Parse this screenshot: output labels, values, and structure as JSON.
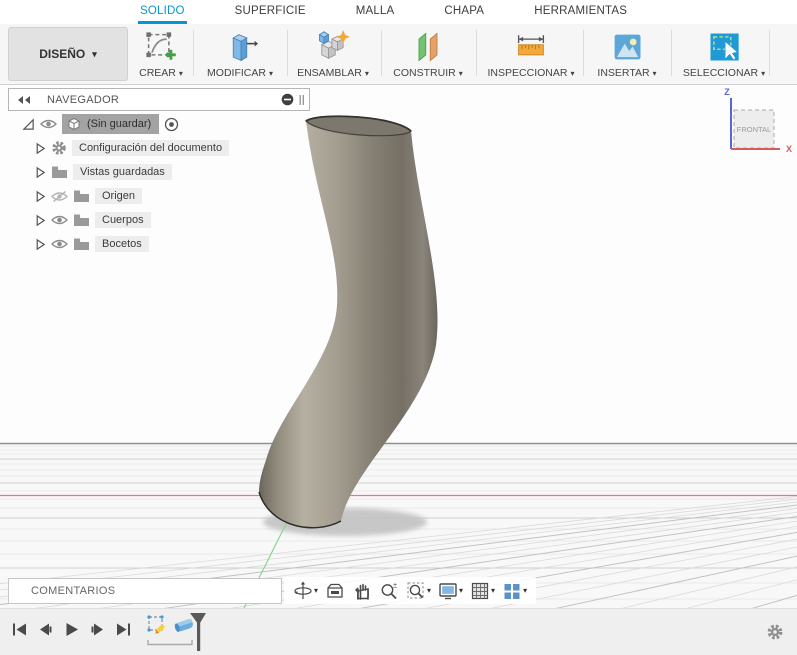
{
  "glyphs": {
    "caret": "▾"
  },
  "tabs": {
    "items": [
      {
        "label": "SOLIDO",
        "active": true
      },
      {
        "label": "SUPERFICIE",
        "active": false
      },
      {
        "label": "MALLA",
        "active": false
      },
      {
        "label": "CHAPA",
        "active": false
      },
      {
        "label": "HERRAMIENTAS",
        "active": false
      }
    ]
  },
  "design_menu": {
    "label": "DISEÑO"
  },
  "toolbar": {
    "groups": [
      {
        "label": "CREAR",
        "icon": "sketch-create-icon"
      },
      {
        "label": "MODIFICAR",
        "icon": "press-pull-icon"
      },
      {
        "label": "ENSAMBLAR",
        "icon": "assemble-icon"
      },
      {
        "label": "CONSTRUIR",
        "icon": "construct-planes-icon"
      },
      {
        "label": "INSPECCIONAR",
        "icon": "measure-icon"
      },
      {
        "label": "INSERTAR",
        "icon": "insert-image-icon"
      },
      {
        "label": "SELECCIONAR",
        "icon": "select-icon"
      }
    ]
  },
  "navigator": {
    "title": "NAVEGADOR",
    "document": {
      "label": "(Sin guardar)"
    },
    "rows": [
      {
        "label": "Configuración del documento",
        "icon": "gear-icon"
      },
      {
        "label": "Vistas guardadas",
        "icon": "folder-icon"
      },
      {
        "label": "Origen",
        "icon": "folder-icon",
        "visible": false
      },
      {
        "label": "Cuerpos",
        "icon": "folder-icon",
        "visible": true
      },
      {
        "label": "Bocetos",
        "icon": "folder-icon",
        "visible": true
      }
    ]
  },
  "viewcube": {
    "face_label": "FRONTAL",
    "z_label": "Z",
    "x_label": "X"
  },
  "comments_panel": {
    "label": "COMENTARIOS"
  },
  "view_toolbar": {
    "icons": [
      "orbit",
      "look-at",
      "pan",
      "zoom",
      "fit",
      "display-settings",
      "grid-settings",
      "viewports"
    ]
  },
  "timeline": {
    "controls": [
      "go-to-start",
      "step-back",
      "play",
      "step-forward",
      "go-to-end"
    ],
    "features": [
      "sketch",
      "sweep"
    ]
  },
  "colors": {
    "accent": "#0696d7",
    "axis_x": "#e57a76",
    "axis_y": "#8fd48f",
    "model_mid": "#9a9487",
    "shadow": "#c2c2c2"
  }
}
